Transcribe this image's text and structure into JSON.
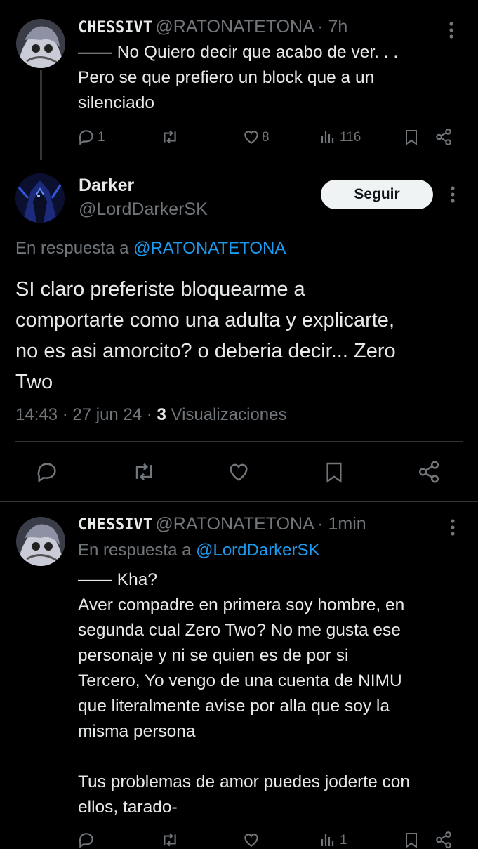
{
  "tweet1": {
    "name": "CHESSIVT",
    "handle": "@RATONATETONA",
    "time": "· 7h",
    "text": "—— No Quiero decir que acabo de ver. . .\nPero se que prefiero un block que a un\nsilenciado",
    "replies": "1",
    "likes": "8",
    "views": "116"
  },
  "main": {
    "name": "Darker",
    "handle": "@LordDarkerSK",
    "follow_label": "Seguir",
    "reply_prefix": "En respuesta a ",
    "reply_to": "@RATONATETONA",
    "text": "SI claro preferiste bloquearme a\ncomportarte como una adulta y explicarte,\nno es asi amorcito? o deberia decir... Zero\nTwo",
    "meta_time": "14:43 · 27 jun 24 · ",
    "meta_views": "3",
    "meta_views_label": " Visualizaciones"
  },
  "tweet3": {
    "name": "CHESSIVT",
    "handle": "@RATONATETONA",
    "time": "· 1min",
    "reply_prefix": "En respuesta a ",
    "reply_to": "@LordDarkerSK",
    "text": "—— Kha?\nAver compadre en primera soy hombre, en\nsegunda cual Zero Two? No me gusta ese\npersonaje y ni se quien es de por si\nTercero, Yo vengo de una cuenta de NIMU\nque literalmente avise por alla que soy la\nmisma persona\n\nTus problemas de amor puedes joderte con\nellos, tarado-",
    "views": "1"
  },
  "colors": {
    "background": "#000000",
    "text": "#e7e9ea",
    "muted": "#71767b",
    "link": "#1d9bf0",
    "button_bg": "#eff3f4"
  },
  "icons": [
    "reply-icon",
    "retweet-icon",
    "like-icon",
    "views-icon",
    "bookmark-icon",
    "share-icon",
    "more-icon"
  ]
}
